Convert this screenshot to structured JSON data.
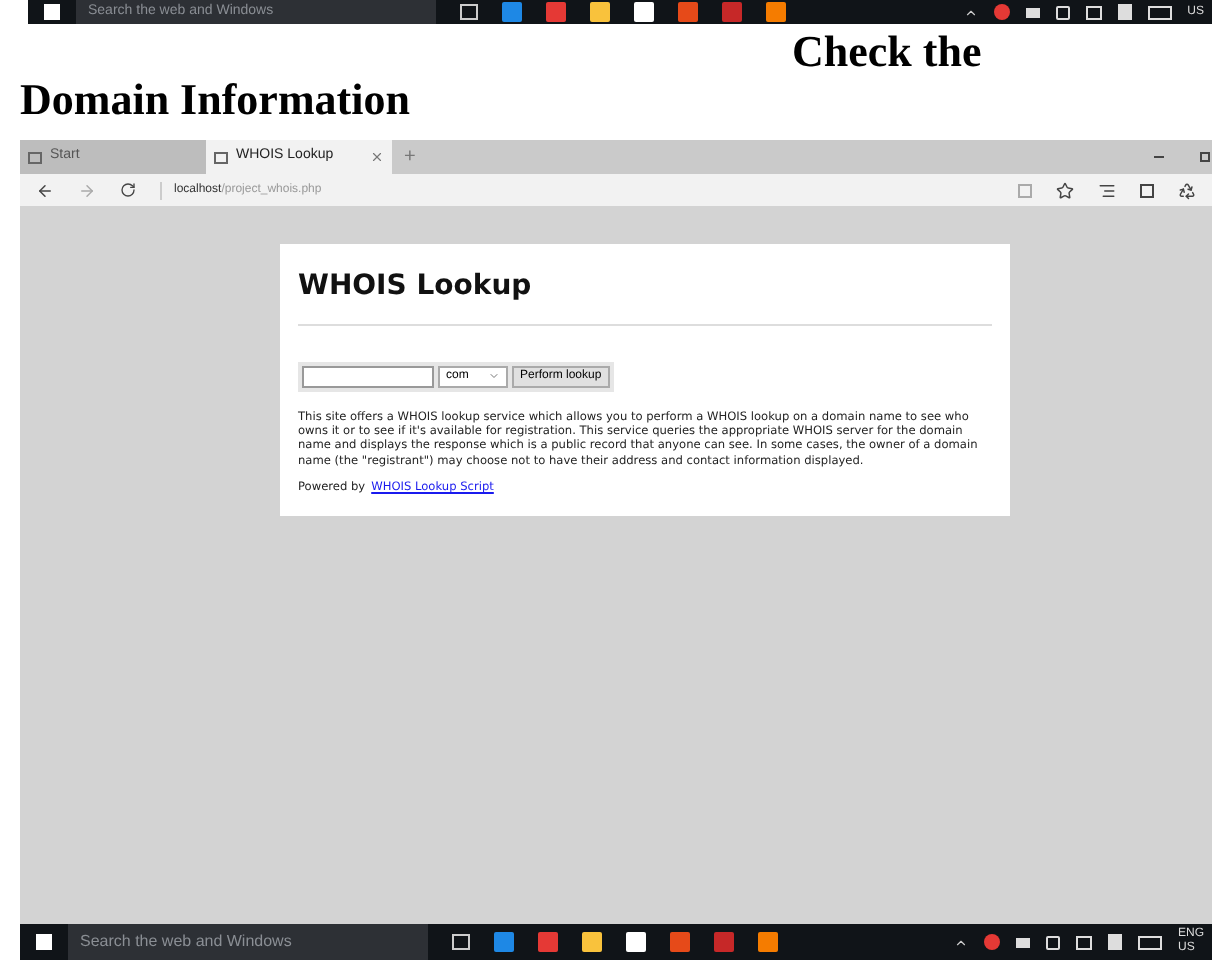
{
  "top_taskbar": {
    "search_placeholder": "Search the web and Windows",
    "language": "US"
  },
  "heading": {
    "line_1": "Check the",
    "line_2": "Domain Information"
  },
  "browser": {
    "tabs": [
      {
        "label": "Start",
        "selected": false
      },
      {
        "label": "WHOIS Lookup",
        "selected": true
      }
    ],
    "new_tab": "+",
    "address": {
      "host": "localhost",
      "path": "/project_whois.php"
    },
    "page": {
      "title": "WHOIS Lookup",
      "tld_select": "com",
      "lookup_button": "Perform lookup",
      "description": "This site offers a WHOIS lookup service which allows you to perform a WHOIS lookup on a domain name to see who owns it or to see if it's available for registration. This service queries the appropriate WHOIS server for the domain name and displays the response which is a public record that anyone can see. In some cases, the owner of a domain name (the \"registrant\") may choose not to have their address and contact information displayed.",
      "powered_by": "Powered by",
      "powered_link": "WHOIS Lookup Script"
    }
  },
  "taskbar": {
    "search_placeholder": "Search the web and Windows",
    "language_1": "ENG",
    "language_2": "US"
  }
}
